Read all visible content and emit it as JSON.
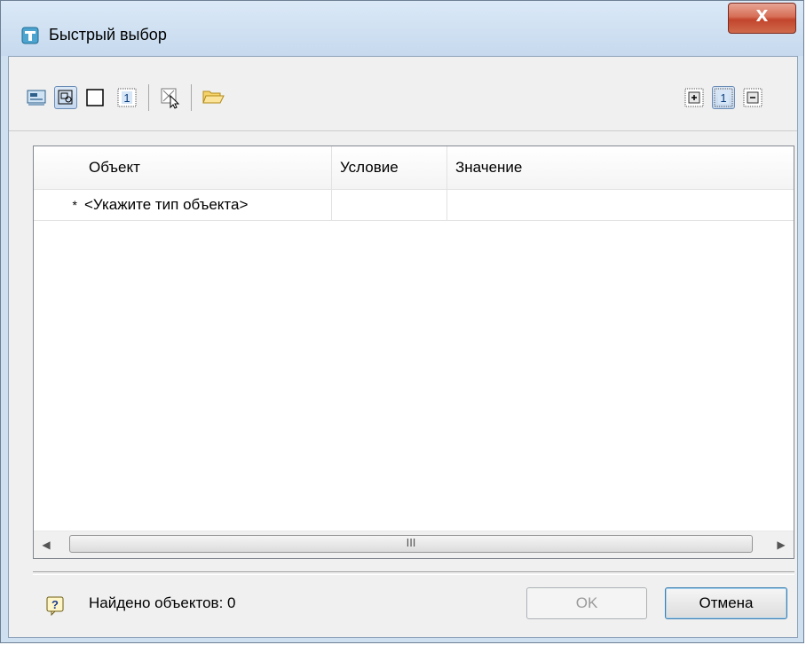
{
  "window": {
    "title": "Быстрый выбор",
    "close_label": "X"
  },
  "toolbar": {
    "left_icons": [
      "apply-to-drawing-icon",
      "select-objects-icon",
      "empty-box-icon",
      "highlight-number-icon",
      "pick-cursor-icon",
      "folder-open-icon"
    ],
    "right_icons": [
      "expand-all-icon",
      "highlight-single-icon",
      "collapse-all-icon"
    ]
  },
  "grid": {
    "columns": [
      "",
      "Объект",
      "Условие",
      "Значение"
    ],
    "rows": [
      {
        "marker": "*",
        "object": "<Укажите тип объекта>",
        "condition": "",
        "value": ""
      }
    ],
    "scroll_grip": "III"
  },
  "status": {
    "text": "Найдено объектов: 0"
  },
  "buttons": {
    "ok": "OK",
    "cancel": "Отмена"
  },
  "colors": {
    "title_bg": "#cfe0f1",
    "client_bg": "#f0f0f0",
    "close_red": "#c2452c",
    "folder_yellow": "#f2c94c",
    "pressed_blue": "#c5d8ef"
  }
}
